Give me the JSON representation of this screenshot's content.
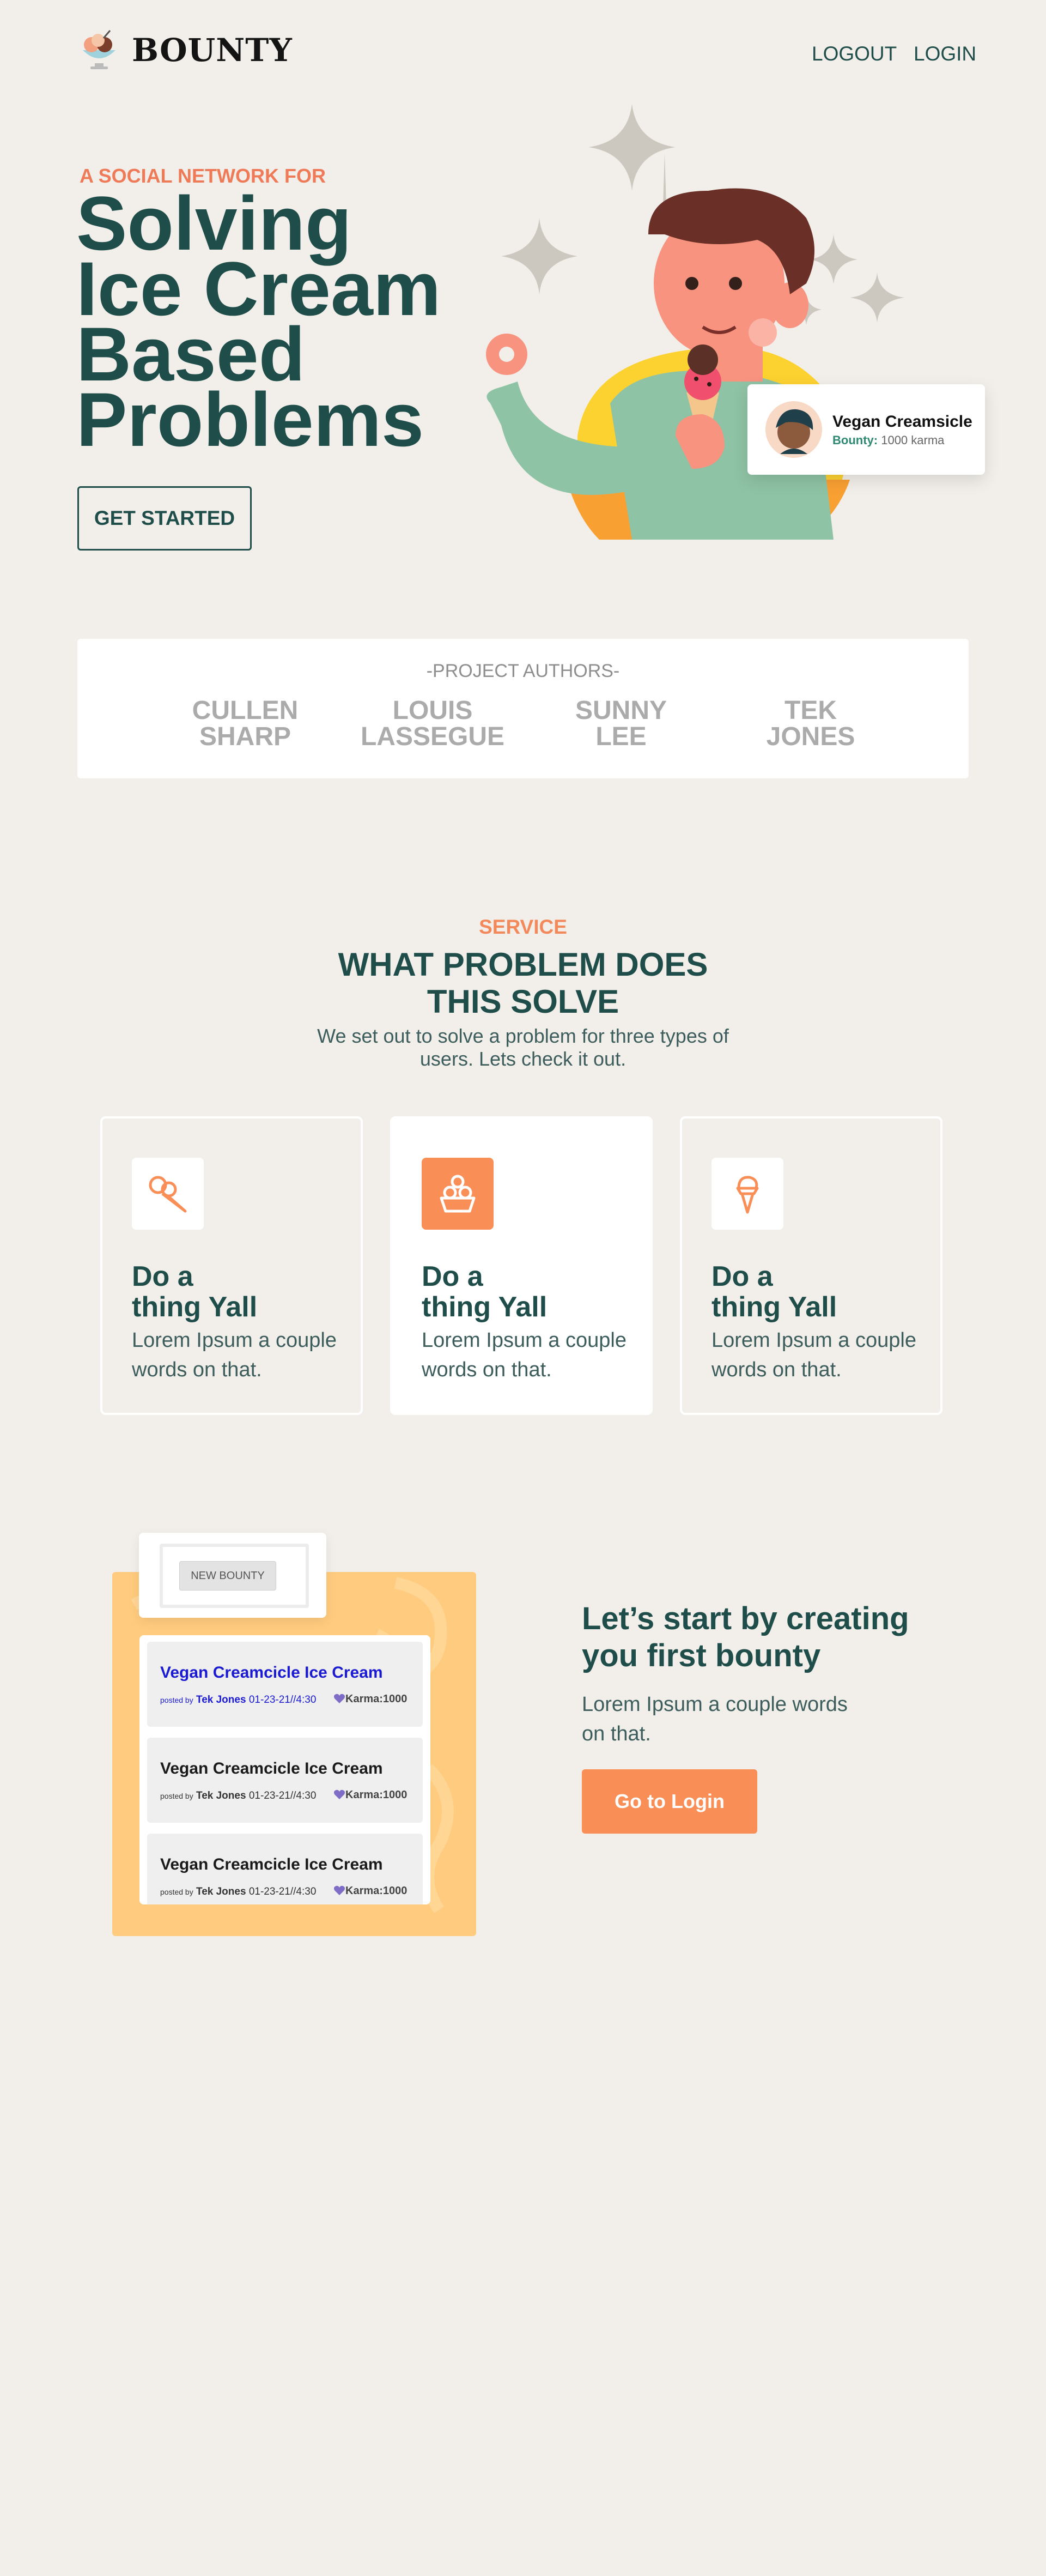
{
  "nav": {
    "brand": "BOUNTY",
    "logo_icon": "ice-cream-bowl-icon",
    "links": {
      "logout": "LOGOUT",
      "login": "LOGIN"
    }
  },
  "hero": {
    "eyebrow": "A SOCIAL NETWORK FOR",
    "title_lines": [
      "Solving",
      "Ice Cream",
      "Based",
      "Problems"
    ],
    "cta_label": "GET STARTED",
    "illustration": "person-eating-ice-cream-illustration",
    "bounty_card": {
      "name": "Vegan Creamsicle",
      "bounty_label": "Bounty:",
      "bounty_value": "1000 karma"
    }
  },
  "authors": {
    "heading": "-PROJECT AUTHORS-",
    "list": [
      {
        "first": "CULLEN",
        "last": "SHARP"
      },
      {
        "first": "LOUIS",
        "last": "LASSEGUE"
      },
      {
        "first": "SUNNY",
        "last": "LEE"
      },
      {
        "first": "TEK",
        "last": "JONES"
      }
    ]
  },
  "service": {
    "eyebrow": "SERVICE",
    "title_lines": [
      "WHAT PROBLEM DOES",
      "THIS SOLVE"
    ],
    "description": "We set out to solve a problem for three types of users. Lets check it out.",
    "cards": [
      {
        "icon": "ice-cream-cone-icon",
        "title_lines": [
          "Do a",
          "thing Yall"
        ],
        "description": "Lorem Ipsum a couple words on that."
      },
      {
        "icon": "ice-cream-cup-icon",
        "title_lines": [
          "Do a",
          "thing Yall"
        ],
        "description": "Lorem Ipsum a couple words on that."
      },
      {
        "icon": "ice-cream-scoop-icon",
        "title_lines": [
          "Do a",
          "thing Yall"
        ],
        "description": "Lorem Ipsum a couple words on that."
      }
    ]
  },
  "preview": {
    "new_bounty_label": "NEW BOUNTY",
    "items": [
      {
        "title": "Vegan Creamcicle Ice Cream",
        "posted_by": "posted by",
        "author": "Tek Jones",
        "date": "01-23-21//4:30",
        "karma": "Karma:1000"
      },
      {
        "title": "Vegan Creamcicle Ice Cream",
        "posted_by": "posted by",
        "author": "Tek Jones",
        "date": "01-23-21//4:30",
        "karma": "Karma:1000"
      },
      {
        "title": "Vegan Creamcicle Ice Cream",
        "posted_by": "posted by",
        "author": "Tek Jones",
        "date": "01-23-21//4:30",
        "karma": "Karma:1000"
      }
    ]
  },
  "cta": {
    "title_lines": [
      "Let’s start by creating",
      "you first bounty"
    ],
    "description": "Lorem Ipsum a couple words on that.",
    "button_label": "Go to Login"
  },
  "colors": {
    "background": "#f2efea",
    "primary_text": "#1f4d4a",
    "accent_orange": "#f98f57",
    "eyebrow_coral": "#ef7a58",
    "panel_yellow": "#ffcb7e"
  }
}
